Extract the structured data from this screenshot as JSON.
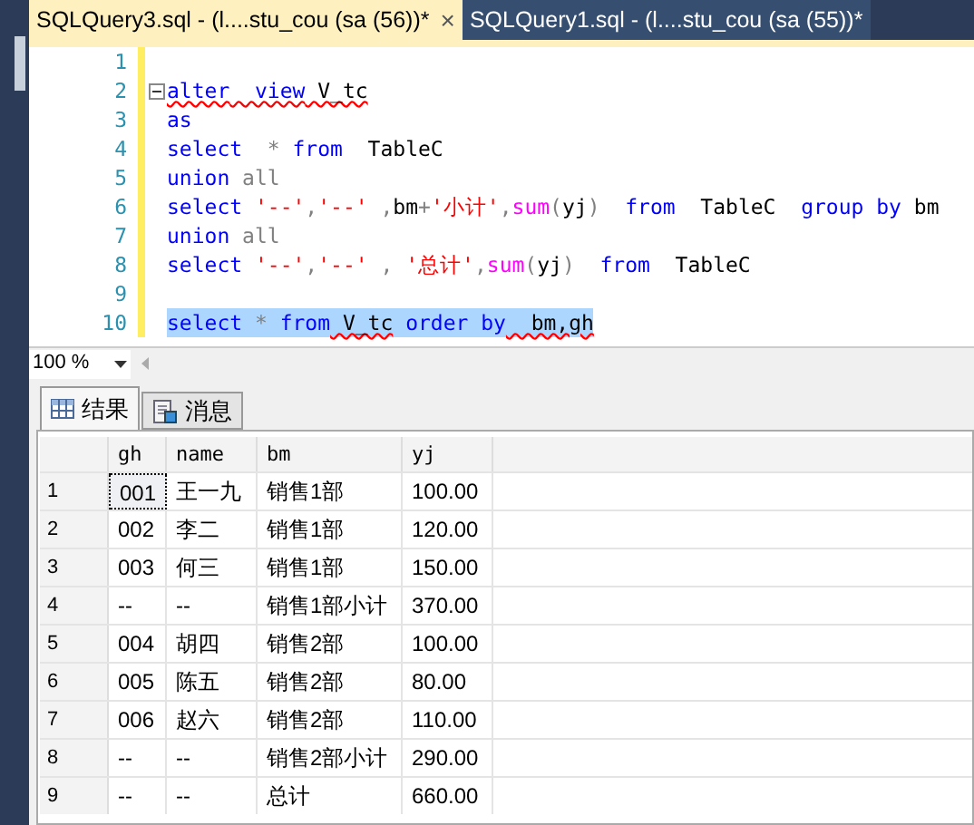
{
  "doc_tabs": [
    {
      "label": "SQLQuery3.sql - (l....stu_cou (sa (56))*",
      "selected": true,
      "close": "×"
    },
    {
      "label": "SQLQuery1.sql - (l....stu_cou (sa (55))*",
      "selected": false
    }
  ],
  "editor": {
    "lines": [
      {
        "number": "1",
        "fold_start": false,
        "selected": false
      },
      {
        "number": "2",
        "fold_start": true,
        "selected": false,
        "segments": [
          {
            "text": "alter",
            "kind": "kw",
            "squiggle": true
          },
          {
            "text": "  view",
            "kind": "kw",
            "squiggle": true
          },
          {
            "text": " V_tc",
            "kind": "id",
            "squiggle": true
          }
        ]
      },
      {
        "number": "3",
        "fold_start": false,
        "selected": false,
        "segments": [
          {
            "text": "as",
            "kind": "kw"
          }
        ]
      },
      {
        "number": "4",
        "fold_start": false,
        "selected": false,
        "segments": [
          {
            "text": "select",
            "kind": "kw"
          },
          {
            "text": "  * ",
            "kind": "op"
          },
          {
            "text": "from",
            "kind": "kw"
          },
          {
            "text": "  TableC",
            "kind": "id"
          }
        ]
      },
      {
        "number": "5",
        "fold_start": false,
        "selected": false,
        "segments": [
          {
            "text": "union",
            "kind": "kw"
          },
          {
            "text": " all",
            "kind": "op"
          }
        ]
      },
      {
        "number": "6",
        "fold_start": false,
        "selected": false,
        "segments": [
          {
            "text": "select ",
            "kind": "kw"
          },
          {
            "text": "'--'",
            "kind": "str"
          },
          {
            "text": ",",
            "kind": "op"
          },
          {
            "text": "'--'",
            "kind": "str"
          },
          {
            "text": " ,",
            "kind": "op"
          },
          {
            "text": "bm",
            "kind": "id"
          },
          {
            "text": "+",
            "kind": "op"
          },
          {
            "text": "'小计'",
            "kind": "str"
          },
          {
            "text": ",",
            "kind": "op"
          },
          {
            "text": "sum",
            "kind": "fn"
          },
          {
            "text": "(",
            "kind": "op"
          },
          {
            "text": "yj",
            "kind": "id"
          },
          {
            "text": ")  ",
            "kind": "op"
          },
          {
            "text": "from",
            "kind": "kw"
          },
          {
            "text": "  TableC  ",
            "kind": "id"
          },
          {
            "text": "group by",
            "kind": "kw"
          },
          {
            "text": " bm",
            "kind": "id"
          }
        ]
      },
      {
        "number": "7",
        "fold_start": false,
        "selected": false,
        "segments": [
          {
            "text": "union",
            "kind": "kw"
          },
          {
            "text": " all",
            "kind": "op"
          }
        ]
      },
      {
        "number": "8",
        "fold_start": false,
        "selected": false,
        "segments": [
          {
            "text": "select ",
            "kind": "kw"
          },
          {
            "text": "'--'",
            "kind": "str"
          },
          {
            "text": ",",
            "kind": "op"
          },
          {
            "text": "'--'",
            "kind": "str"
          },
          {
            "text": " , ",
            "kind": "op"
          },
          {
            "text": "'总计'",
            "kind": "str"
          },
          {
            "text": ",",
            "kind": "op"
          },
          {
            "text": "sum",
            "kind": "fn"
          },
          {
            "text": "(",
            "kind": "op"
          },
          {
            "text": "yj",
            "kind": "id"
          },
          {
            "text": ")  ",
            "kind": "op"
          },
          {
            "text": "from",
            "kind": "kw"
          },
          {
            "text": "  TableC",
            "kind": "id"
          }
        ]
      },
      {
        "number": "9",
        "fold_start": false,
        "selected": false
      },
      {
        "number": "10",
        "fold_start": false,
        "selected": true,
        "segments": [
          {
            "text": "select",
            "kind": "kw"
          },
          {
            "text": " * ",
            "kind": "op"
          },
          {
            "text": "from",
            "kind": "kw"
          },
          {
            "text": " V_tc",
            "kind": "id",
            "squiggle": true
          },
          {
            "text": " order by",
            "kind": "kw",
            "squiggle": false
          },
          {
            "text": "  bm,gh",
            "kind": "id",
            "squiggle": true
          }
        ]
      }
    ]
  },
  "zoom": "100 %",
  "result_tabs": [
    {
      "label": "结果",
      "selected": true,
      "kind": "grid"
    },
    {
      "label": "消息",
      "selected": false,
      "kind": "messages"
    }
  ],
  "grid": {
    "columns": [
      "gh",
      "name",
      "bm",
      "yj"
    ],
    "rows": [
      {
        "index": "1",
        "focused": true,
        "cells": [
          "001",
          "王一九",
          "销售1部",
          "100.00"
        ]
      },
      {
        "index": "2",
        "focused": false,
        "cells": [
          "002",
          "李二",
          "销售1部",
          "120.00"
        ]
      },
      {
        "index": "3",
        "focused": false,
        "cells": [
          "003",
          "何三",
          "销售1部",
          "150.00"
        ]
      },
      {
        "index": "4",
        "focused": false,
        "cells": [
          "--",
          "--",
          "销售1部小计",
          "370.00"
        ]
      },
      {
        "index": "5",
        "focused": false,
        "cells": [
          "004",
          "胡四",
          "销售2部",
          "100.00"
        ]
      },
      {
        "index": "6",
        "focused": false,
        "cells": [
          "005",
          "陈五",
          "销售2部",
          "80.00"
        ]
      },
      {
        "index": "7",
        "focused": false,
        "cells": [
          "006",
          "赵六",
          "销售2部",
          "110.00"
        ]
      },
      {
        "index": "8",
        "focused": false,
        "cells": [
          "--",
          "--",
          "销售2部小计",
          "290.00"
        ]
      },
      {
        "index": "9",
        "focused": false,
        "cells": [
          "--",
          "--",
          "总计",
          "660.00"
        ]
      }
    ]
  }
}
